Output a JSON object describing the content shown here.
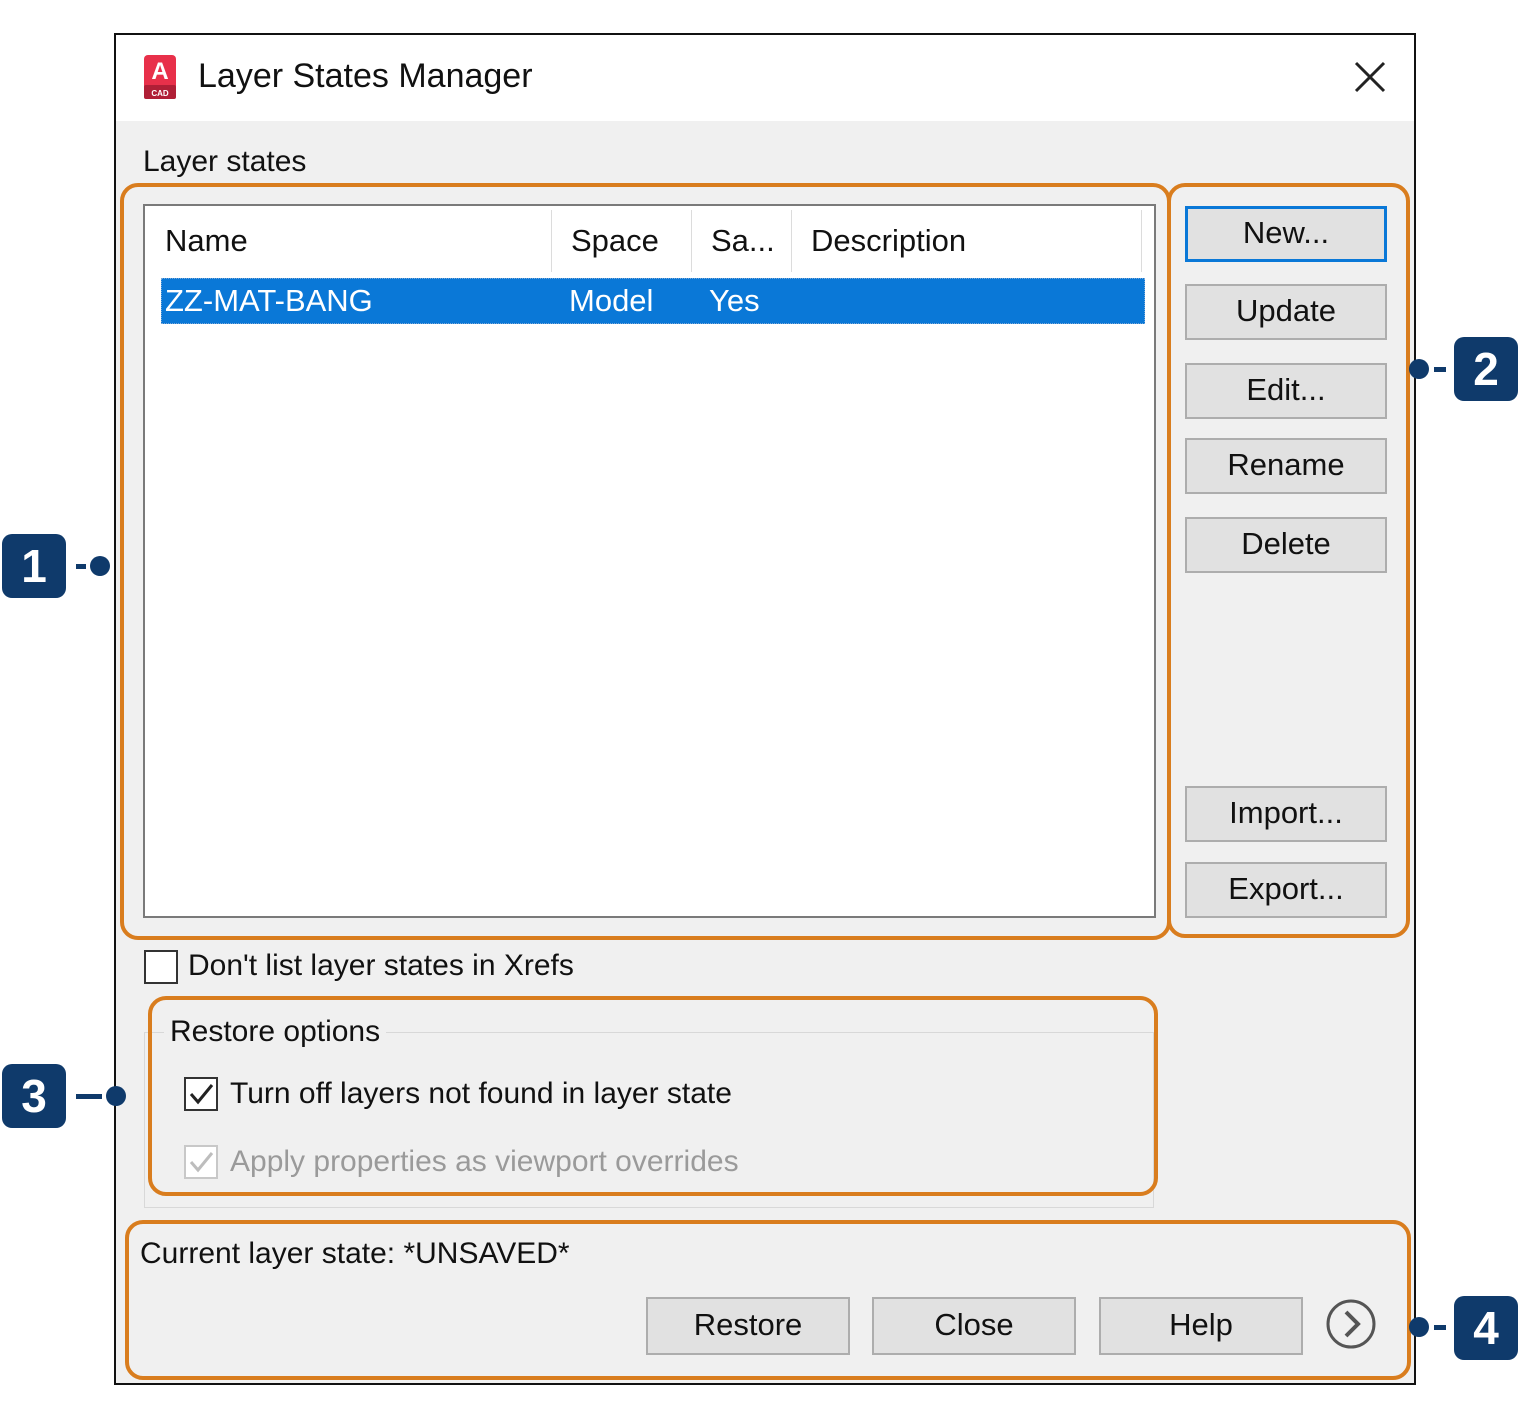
{
  "window": {
    "title": "Layer States Manager",
    "icon": "autocad-app-icon",
    "icon_letter": "A",
    "icon_sub": "CAD"
  },
  "layer_states": {
    "label": "Layer states",
    "columns": [
      "Name",
      "Space",
      "Sa...",
      "Description"
    ],
    "rows": [
      {
        "name": "ZZ-MAT-BANG",
        "space": "Model",
        "saved": "Yes",
        "description": ""
      }
    ]
  },
  "side_buttons": {
    "new": "New...",
    "update": "Update",
    "edit": "Edit...",
    "rename": "Rename",
    "delete": "Delete",
    "import": "Import...",
    "export": "Export..."
  },
  "xrefs_option": {
    "label": "Don't list layer states in Xrefs",
    "checked": false
  },
  "restore_options": {
    "title": "Restore options",
    "turn_off": {
      "label": "Turn off layers not found in layer state",
      "checked": true
    },
    "apply_props": {
      "label": "Apply properties as viewport overrides",
      "checked": true,
      "disabled": true
    }
  },
  "footer": {
    "current_state": "Current layer state: *UNSAVED*",
    "restore": "Restore",
    "close": "Close",
    "help": "Help"
  },
  "callouts": [
    "1",
    "2",
    "3",
    "4"
  ],
  "colors": {
    "highlight": "#d97d1e",
    "callout": "#0f3a6b",
    "selection": "#0a78d7",
    "dialog_bg": "#f0f0f0"
  }
}
